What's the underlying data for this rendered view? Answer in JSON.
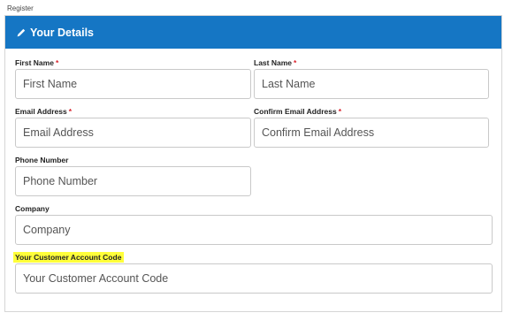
{
  "breadcrumb": "Register",
  "panel": {
    "title": "Your Details",
    "icon": "pencil-icon",
    "accent": "#1576c4"
  },
  "form": {
    "first_name": {
      "label": "First Name",
      "required": "*",
      "placeholder": "First Name"
    },
    "last_name": {
      "label": "Last Name",
      "required": "*",
      "placeholder": "Last Name"
    },
    "email": {
      "label": "Email Address",
      "required": "*",
      "placeholder": "Email Address"
    },
    "confirm_email": {
      "label": "Confirm Email Address",
      "required": "*",
      "placeholder": "Confirm Email Address"
    },
    "phone": {
      "label": "Phone Number",
      "placeholder": "Phone Number"
    },
    "company": {
      "label": "Company",
      "placeholder": "Company"
    },
    "account_code": {
      "label": "Your Customer Account Code",
      "placeholder": "Your Customer Account Code",
      "highlight": "#ffff3a"
    }
  }
}
